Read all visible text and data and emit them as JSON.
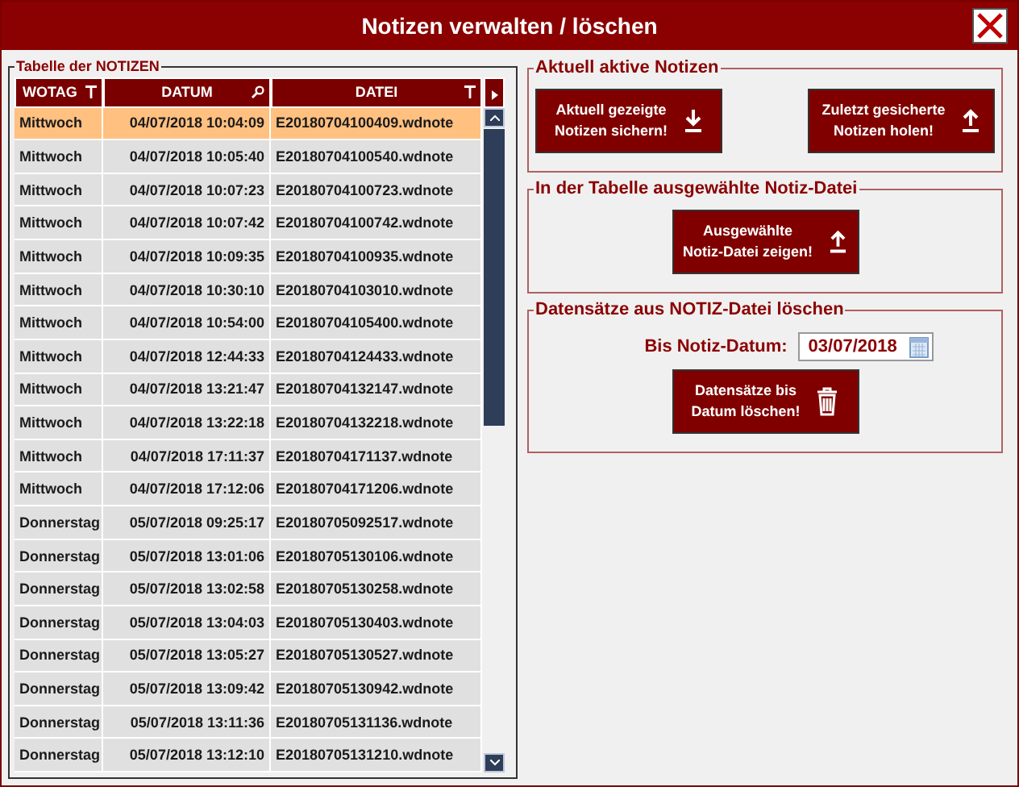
{
  "window": {
    "title": "Notizen verwalten / löschen"
  },
  "table": {
    "title": "Tabelle der NOTIZEN",
    "columns": [
      {
        "label": "WOTAG",
        "kind": "filter"
      },
      {
        "label": "DATUM",
        "kind": "search"
      },
      {
        "label": "DATEI",
        "kind": "filter"
      }
    ],
    "rows": [
      {
        "wotag": "Mittwoch",
        "datum": "04/07/2018 10:04:09",
        "datei": "E20180704100409.wdnote",
        "selected": true
      },
      {
        "wotag": "Mittwoch",
        "datum": "04/07/2018 10:05:40",
        "datei": "E20180704100540.wdnote",
        "selected": false
      },
      {
        "wotag": "Mittwoch",
        "datum": "04/07/2018 10:07:23",
        "datei": "E20180704100723.wdnote",
        "selected": false
      },
      {
        "wotag": "Mittwoch",
        "datum": "04/07/2018 10:07:42",
        "datei": "E20180704100742.wdnote",
        "selected": false
      },
      {
        "wotag": "Mittwoch",
        "datum": "04/07/2018 10:09:35",
        "datei": "E20180704100935.wdnote",
        "selected": false
      },
      {
        "wotag": "Mittwoch",
        "datum": "04/07/2018 10:30:10",
        "datei": "E20180704103010.wdnote",
        "selected": false
      },
      {
        "wotag": "Mittwoch",
        "datum": "04/07/2018 10:54:00",
        "datei": "E20180704105400.wdnote",
        "selected": false
      },
      {
        "wotag": "Mittwoch",
        "datum": "04/07/2018 12:44:33",
        "datei": "E20180704124433.wdnote",
        "selected": false
      },
      {
        "wotag": "Mittwoch",
        "datum": "04/07/2018 13:21:47",
        "datei": "E20180704132147.wdnote",
        "selected": false
      },
      {
        "wotag": "Mittwoch",
        "datum": "04/07/2018 13:22:18",
        "datei": "E20180704132218.wdnote",
        "selected": false
      },
      {
        "wotag": "Mittwoch",
        "datum": "04/07/2018 17:11:37",
        "datei": "E20180704171137.wdnote",
        "selected": false
      },
      {
        "wotag": "Mittwoch",
        "datum": "04/07/2018 17:12:06",
        "datei": "E20180704171206.wdnote",
        "selected": false
      },
      {
        "wotag": "Donnerstag",
        "datum": "05/07/2018 09:25:17",
        "datei": "E20180705092517.wdnote",
        "selected": false
      },
      {
        "wotag": "Donnerstag",
        "datum": "05/07/2018 13:01:06",
        "datei": "E20180705130106.wdnote",
        "selected": false
      },
      {
        "wotag": "Donnerstag",
        "datum": "05/07/2018 13:02:58",
        "datei": "E20180705130258.wdnote",
        "selected": false
      },
      {
        "wotag": "Donnerstag",
        "datum": "05/07/2018 13:04:03",
        "datei": "E20180705130403.wdnote",
        "selected": false
      },
      {
        "wotag": "Donnerstag",
        "datum": "05/07/2018 13:05:27",
        "datei": "E20180705130527.wdnote",
        "selected": false
      },
      {
        "wotag": "Donnerstag",
        "datum": "05/07/2018 13:09:42",
        "datei": "E20180705130942.wdnote",
        "selected": false
      },
      {
        "wotag": "Donnerstag",
        "datum": "05/07/2018 13:11:36",
        "datei": "E20180705131136.wdnote",
        "selected": false
      },
      {
        "wotag": "Donnerstag",
        "datum": "05/07/2018 13:12:10",
        "datei": "E20180705131210.wdnote",
        "selected": false
      }
    ]
  },
  "groups": [
    {
      "title": "Aktuell aktive Notizen",
      "buttons": [
        {
          "label": "Aktuell gezeigte\nNotizen sichern!",
          "kind": "download"
        },
        {
          "label": "Zuletzt gesicherte\nNotizen holen!",
          "kind": "upload"
        }
      ]
    },
    {
      "title": "In der Tabelle ausgewählte Notiz-Datei",
      "buttons": [
        {
          "label": "Ausgewählte\nNotiz-Datei zeigen!",
          "kind": "upload"
        }
      ]
    },
    {
      "title": "Datensätze aus NOTIZ-Datei löschen",
      "date_label": "Bis Notiz-Datum:",
      "date_value": "03/07/2018",
      "buttons": [
        {
          "label": "Datensätze bis\nDatum löschen!",
          "kind": "trash"
        }
      ]
    }
  ]
}
